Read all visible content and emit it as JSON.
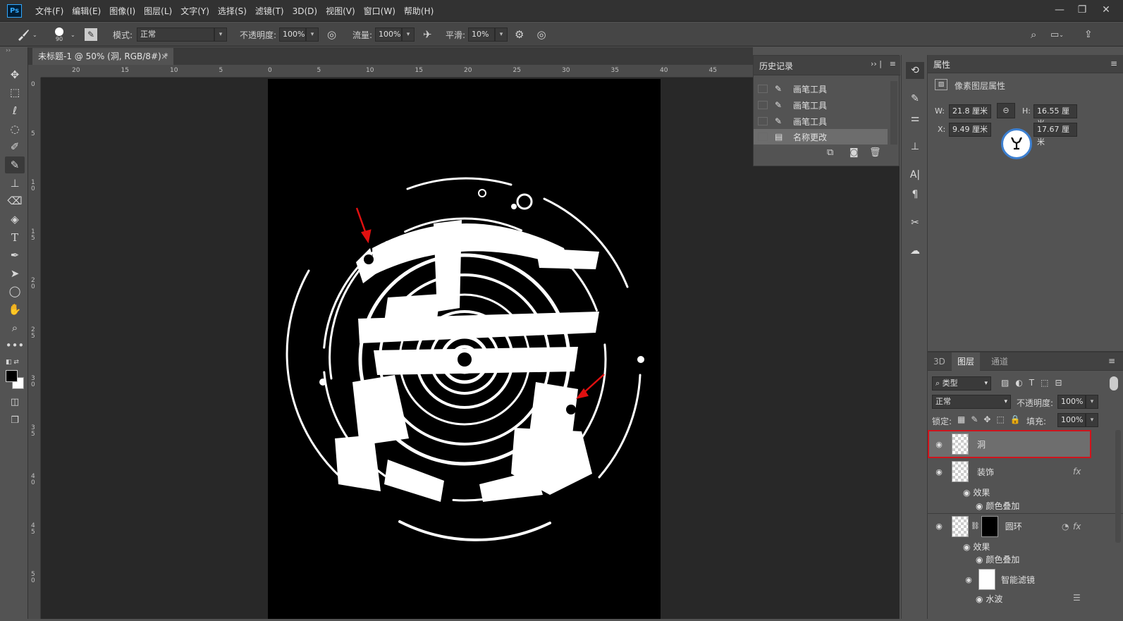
{
  "app": {
    "logo": "Ps"
  },
  "menu": [
    "文件(F)",
    "编辑(E)",
    "图像(I)",
    "图层(L)",
    "文字(Y)",
    "选择(S)",
    "滤镜(T)",
    "3D(D)",
    "视图(V)",
    "窗口(W)",
    "帮助(H)"
  ],
  "window_controls": {
    "minimize": "—",
    "restore": "❐",
    "close": "✕"
  },
  "options": {
    "brush_size": "90",
    "mode_label": "模式:",
    "mode_value": "正常",
    "opacity_label": "不透明度:",
    "opacity_value": "100%",
    "flow_label": "流量:",
    "flow_value": "100%",
    "smooth_label": "平滑:",
    "smooth_value": "10%"
  },
  "document": {
    "tab_title": "未标题-1 @ 50% (洞, RGB/8#) *",
    "close": "×"
  },
  "ruler": {
    "h_ticks": [
      "20",
      "15",
      "10",
      "5",
      "0",
      "5",
      "10",
      "15",
      "20",
      "25",
      "30",
      "35",
      "40",
      "45"
    ],
    "v_ticks": [
      "0",
      "5",
      "1 0",
      "1 5",
      "2 0",
      "2 5",
      "3 0",
      "3 5",
      "4 0",
      "4 5",
      "5 0"
    ]
  },
  "history": {
    "title": "历史记录",
    "items": [
      {
        "label": "画笔工具",
        "icon": "brush-icon"
      },
      {
        "label": "画笔工具",
        "icon": "brush-icon"
      },
      {
        "label": "画笔工具",
        "icon": "brush-icon"
      },
      {
        "label": "名称更改",
        "icon": "document-icon"
      }
    ]
  },
  "properties": {
    "title": "属性",
    "subtitle": "像素图层属性",
    "w_label": "W:",
    "w_value": "21.8 厘米",
    "h_label": "H:",
    "h_value": "16.55 厘米",
    "x_label": "X:",
    "x_value": "9.49 厘米",
    "y_value": "17.67 厘米"
  },
  "layers_panel": {
    "tabs": [
      "3D",
      "图层",
      "通道"
    ],
    "active_tab": "图层",
    "filter_kind": "类型",
    "blend_mode": "正常",
    "opacity_label": "不透明度:",
    "opacity_value": "100%",
    "lock_label": "锁定:",
    "fill_label": "填充:",
    "fill_value": "100%",
    "layers": [
      {
        "name": "洞",
        "selected": true
      },
      {
        "name": "装饰",
        "fx": "fx",
        "effects_label": "效果",
        "effect": "颜色叠加"
      },
      {
        "name": "圆环",
        "fx": "fx",
        "effects_label": "效果",
        "effect": "颜色叠加",
        "smart_filters": "智能滤镜",
        "filter": "水波"
      }
    ]
  },
  "colors": {
    "highlight": "#d0141c",
    "annotation_arrow": "#e01010"
  }
}
